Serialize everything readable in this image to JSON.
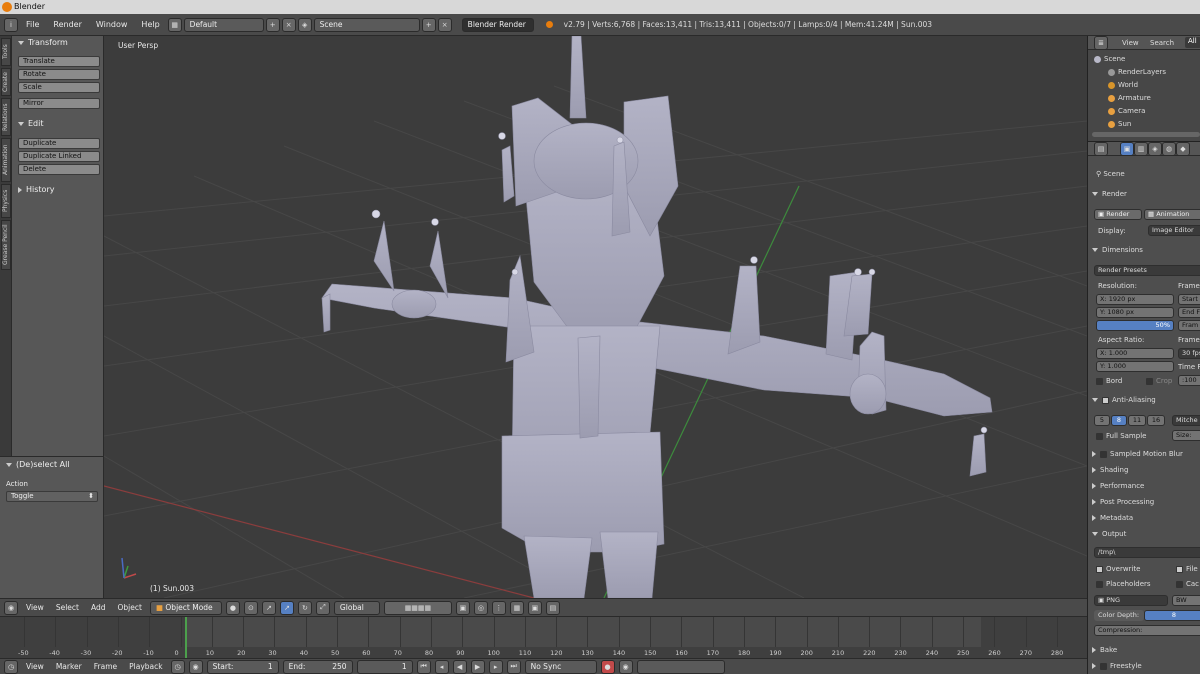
{
  "window": {
    "title": "Blender"
  },
  "menu": {
    "items": [
      "File",
      "Render",
      "Window",
      "Help"
    ]
  },
  "layout": {
    "screen": "Default",
    "scene": "Scene",
    "engine": "Blender Render"
  },
  "stats": {
    "text": "v2.79 | Verts:6,768 | Faces:13,411 | Tris:13,411 | Objects:0/7 | Lamps:0/4 | Mem:41.24M | Sun.003"
  },
  "left_tabs": [
    "Tools",
    "Create",
    "Relations",
    "Animation",
    "Physics",
    "Grease Pencil"
  ],
  "toolshelf": {
    "transform_header": "Transform",
    "translate": "Translate",
    "rotate": "Rotate",
    "scale": "Scale",
    "mirror": "Mirror",
    "edit_header": "Edit",
    "duplicate": "Duplicate",
    "duplicate_linked": "Duplicate Linked",
    "delete": "Delete",
    "history_header": "History"
  },
  "operator": {
    "title": "(De)select All",
    "action_label": "Action",
    "action_value": "Toggle"
  },
  "viewport": {
    "view_label": "User Persp",
    "object_label": "(1) Sun.003"
  },
  "outliner": {
    "view": "View",
    "search": "Search",
    "all": "All",
    "items": [
      "Scene",
      "RenderLayers",
      "World",
      "Armature",
      "Camera",
      "Sun"
    ]
  },
  "properties": {
    "context": "Scene",
    "render_header": "Render",
    "render_btn": "Render",
    "animation_btn": "Animation",
    "display_label": "Display:",
    "display_value": "Image Editor",
    "dimensions_header": "Dimensions",
    "render_presets": "Render Presets",
    "resolution_label": "Resolution:",
    "frame_range_label": "Frame",
    "res_x": "X:  1920 px",
    "res_y": "Y:  1080 px",
    "res_pct": "50%",
    "start_short": "Start",
    "end_short": "End F",
    "frame_short": "Fram",
    "aspect_label": "Aspect Ratio:",
    "frame_rate_label": "Frame",
    "asp_x": "X:  1.000",
    "asp_y": "Y:  1.000",
    "fps": "30 fps",
    "time_label": "Time R",
    "border": "Bord",
    "crop": "Crop",
    "time_val": ":100",
    "anti_aliasing": "Anti-Aliasing",
    "aa_5": "5",
    "aa_8": "8",
    "aa_11": "11",
    "aa_16": "16",
    "aa_filter": "Mitche",
    "full_sample": "Full Sample",
    "size": "Size:",
    "sampled_motion_blur": "Sampled Motion Blur",
    "shading": "Shading",
    "performance": "Performance",
    "post_processing": "Post Processing",
    "metadata": "Metadata",
    "output": "Output",
    "output_path": "/tmp\\",
    "overwrite": "Overwrite",
    "file_ext": "File",
    "placeholders": "Placeholders",
    "cache": "Cac",
    "format": "PNG",
    "bw": "BW",
    "color_depth_label": "Color Depth:",
    "color_depth_value": "8",
    "compression": "Compression:",
    "bake": "Bake",
    "freestyle": "Freestyle"
  },
  "viewport_header": {
    "view": "View",
    "select": "Select",
    "add": "Add",
    "object": "Object",
    "mode": "Object Mode",
    "orientation": "Global"
  },
  "timeline": {
    "ticks": [
      "-50",
      "-40",
      "-30",
      "-20",
      "-10",
      "0",
      "10",
      "20",
      "30",
      "40",
      "50",
      "60",
      "70",
      "80",
      "90",
      "100",
      "110",
      "120",
      "130",
      "140",
      "150",
      "160",
      "170",
      "180",
      "190",
      "200",
      "210",
      "220",
      "230",
      "240",
      "250",
      "260",
      "270",
      "280"
    ],
    "current_frame": 1,
    "view": "View",
    "marker": "Marker",
    "frame": "Frame",
    "playback": "Playback",
    "start_label": "Start:",
    "start_value": "1",
    "end_label": "End:",
    "end_value": "250",
    "current_value": "1",
    "sync": "No Sync"
  },
  "colors": {
    "accent_orange": "#e87d0d",
    "selection_blue": "#5680c2",
    "grid_green": "#3d8b3d",
    "grid_red": "#8b3d3d"
  }
}
